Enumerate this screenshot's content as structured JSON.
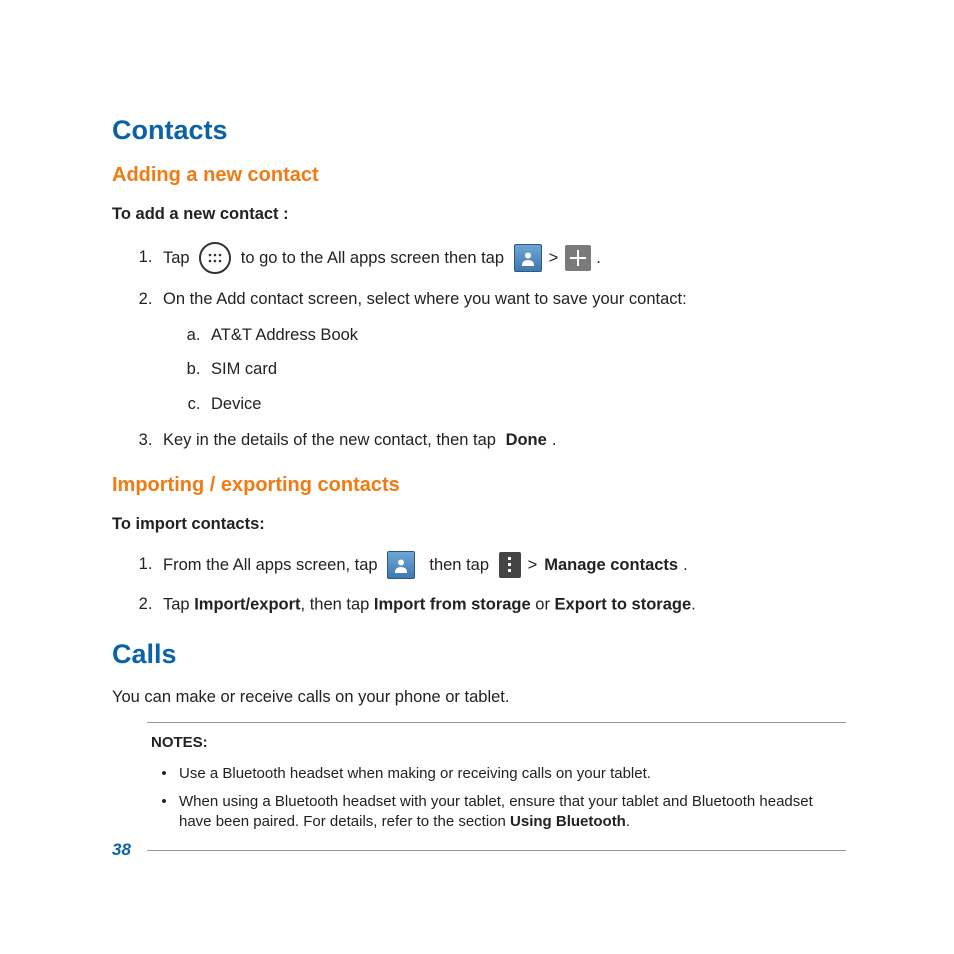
{
  "page_number": "38",
  "sections": {
    "contacts": {
      "title": "Contacts",
      "adding": {
        "title": "Adding a new contact",
        "lead": "To add a new contact :",
        "step1_a": "Tap ",
        "step1_b": " to go to the All apps screen then tap ",
        "step1_c": ".",
        "step2": "On the Add contact screen, select where you want to save your contact:",
        "step2a": "AT&T Address Book",
        "step2b": "SIM card",
        "step2c": "Device",
        "step3_a": "Key in the details of the new contact, then tap ",
        "step3_bold": "Done",
        "step3_b": "."
      },
      "importing": {
        "title": "Importing / exporting contacts",
        "lead": "To import contacts:",
        "step1_a": "From the All apps screen, tap ",
        "step1_b": "  then tap ",
        "step1_bold": "Manage contacts",
        "step1_c": ".",
        "step2_a": "Tap ",
        "step2_bold1": "Import/export",
        "step2_b": ", then tap ",
        "step2_bold2": "Import from storage",
        "step2_c": " or ",
        "step2_bold3": "Export to storage",
        "step2_d": "."
      }
    },
    "calls": {
      "title": "Calls",
      "body": "You can make or receive calls on your phone or tablet.",
      "notes_label": "NOTES:",
      "note1": "Use a Bluetooth headset when making or receiving calls on your tablet.",
      "note2_a": "When using a Bluetooth headset with your tablet, ensure that your tablet and Bluetooth headset have been paired. For details, refer to the section ",
      "note2_bold": "Using Bluetooth",
      "note2_b": "."
    }
  },
  "symbols": {
    "gt": ">"
  }
}
